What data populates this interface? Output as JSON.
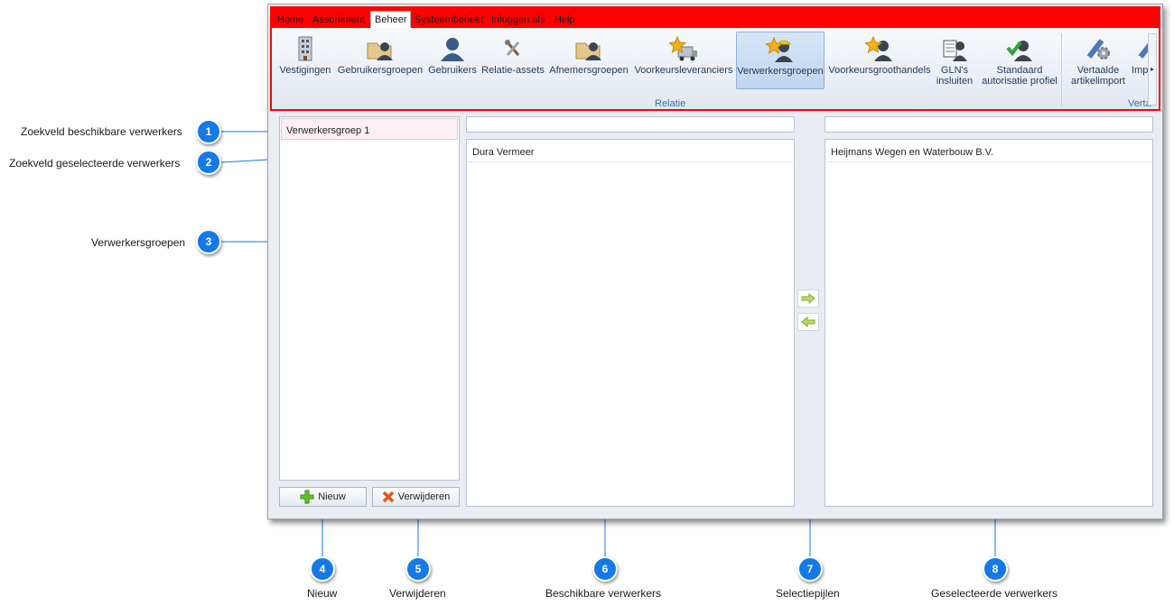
{
  "menu": {
    "items": [
      "Home",
      "Assortiment",
      "Beheer",
      "Systeembeheer",
      "Inloggen als",
      "Help"
    ],
    "active": "Beheer"
  },
  "ribbon": {
    "tools": [
      {
        "label": "Vestigingen",
        "icon": "building-icon"
      },
      {
        "label": "Gebruikersgroepen",
        "icon": "user-group-folder-icon"
      },
      {
        "label": "Gebruikers",
        "icon": "user-icon"
      },
      {
        "label": "Relatie-assets",
        "icon": "tools-icon"
      },
      {
        "label": "Afnemersgroepen",
        "icon": "customer-group-folder-icon"
      },
      {
        "label": "Voorkeursleveranciers",
        "icon": "star-truck-icon"
      },
      {
        "label": "Verwerkersgroepen",
        "icon": "star-worker-icon"
      },
      {
        "label": "Voorkeursgroothandels",
        "icon": "star-user-icon"
      },
      {
        "label_line1": "GLN's",
        "label_line2": "insluiten",
        "icon": "document-user-icon"
      },
      {
        "label_line1": "Standaard",
        "label_line2": "autorisatie profiel",
        "icon": "check-user-icon"
      },
      {
        "label_line1": "Vertaalde",
        "label_line2": "artikelimport",
        "icon": "gear-pencil-icon"
      },
      {
        "label": "Impo",
        "icon": "import-icon"
      }
    ],
    "groups": [
      "Relatie",
      "Verta"
    ],
    "accent": "#ff0000"
  },
  "panes": {
    "groups_list": {
      "rows": [
        "Verwerkersgroep 1"
      ]
    },
    "available_list": {
      "rows": [
        "Dura Vermeer"
      ]
    },
    "selected_list": {
      "rows": [
        "Heijmans Wegen en Waterbouw B.V."
      ]
    },
    "new_button": "Nieuw",
    "delete_button": "Verwijderen"
  },
  "callouts": [
    {
      "n": "1",
      "label": "Zoekveld beschikbare verwerkers"
    },
    {
      "n": "2",
      "label": "Zoekveld geselecteerde verwerkers"
    },
    {
      "n": "3",
      "label": "Verwerkersgroepen"
    },
    {
      "n": "4",
      "label": "Nieuw"
    },
    {
      "n": "5",
      "label": "Verwijderen"
    },
    {
      "n": "6",
      "label": "Beschikbare verwerkers"
    },
    {
      "n": "7",
      "label": "Selectiepijlen"
    },
    {
      "n": "8",
      "label": "Geselecteerde verwerkers"
    }
  ],
  "colors": {
    "callout_blue": "#1579e6",
    "line_blue": "#1579e6"
  }
}
